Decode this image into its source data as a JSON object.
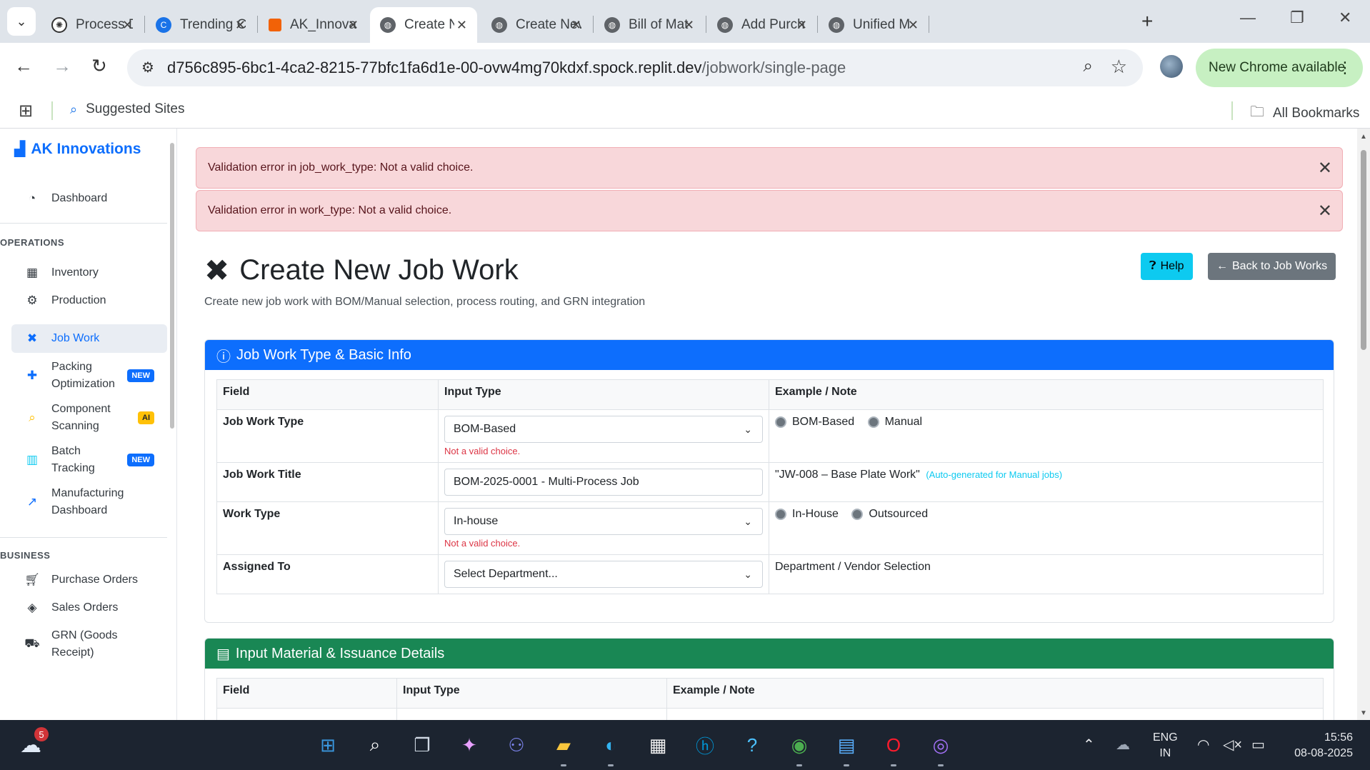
{
  "browser": {
    "tabs": [
      {
        "label": "Process De",
        "favicon": "openai-icon",
        "color": "#333333"
      },
      {
        "label": "Trending C",
        "favicon": "c-logo-icon",
        "color": "#1a73e8"
      },
      {
        "label": "AK_Innova",
        "favicon": "replit-icon",
        "color": "#f26207"
      },
      {
        "label": "Create Nev",
        "favicon": "globe-icon",
        "color": "#5f6368",
        "active": true
      },
      {
        "label": "Create Nev",
        "favicon": "globe-icon",
        "color": "#5f6368"
      },
      {
        "label": "Bill of Mat",
        "favicon": "globe-icon",
        "color": "#5f6368"
      },
      {
        "label": "Add Purch",
        "favicon": "globe-icon",
        "color": "#5f6368"
      },
      {
        "label": "Unified M",
        "favicon": "globe-icon",
        "color": "#5f6368"
      }
    ],
    "url_host": "d756c895-6bc1-4ca2-8215-77bfc1fa6d1e-00-ovw4mg70kdxf.spock.replit.dev",
    "url_path": "/jobwork/single-page",
    "new_chrome_label": "New Chrome available",
    "bookmarks": {
      "suggested": "Suggested Sites",
      "all": "All Bookmarks"
    }
  },
  "sidebar": {
    "brand": "AK Innovations",
    "dashboard": "Dashboard",
    "operations_heading": "OPERATIONS",
    "operations": [
      {
        "label": "Inventory",
        "icon": "boxes-icon"
      },
      {
        "label": "Production",
        "icon": "cogs-icon"
      },
      {
        "label": "Job Work",
        "icon": "tools-icon",
        "active": true
      },
      {
        "label_line1": "Packing",
        "label_line2": "Optimization",
        "icon": "puzzle-icon",
        "badge": "NEW"
      },
      {
        "label_line1": "Component",
        "label_line2": "Scanning",
        "icon": "search-icon",
        "badge": "AI"
      },
      {
        "label_line1": "Batch",
        "label_line2": "Tracking",
        "icon": "barcode-icon",
        "badge": "NEW"
      },
      {
        "label_line1": "Manufacturing",
        "label_line2": "Dashboard",
        "icon": "chart-line-icon"
      }
    ],
    "business_heading": "BUSINESS",
    "business": [
      {
        "label": "Purchase Orders",
        "icon": "cart-icon"
      },
      {
        "label": "Sales Orders",
        "icon": "handshake-icon"
      },
      {
        "label_line1": "GRN (Goods",
        "label_line2": "Receipt)",
        "icon": "truck-icon"
      }
    ]
  },
  "alerts": [
    "Validation error in job_work_type: Not a valid choice.",
    "Validation error in work_type: Not a valid choice."
  ],
  "page": {
    "title": "Create New Job Work",
    "subtitle": "Create new job work with BOM/Manual selection, process routing, and GRN integration",
    "help_label": "Help",
    "back_label": "Back to Job Works"
  },
  "section1": {
    "title": "Job Work Type & Basic Info",
    "headers": {
      "field": "Field",
      "input": "Input Type",
      "note": "Example / Note"
    },
    "rows": {
      "job_work_type": {
        "field": "Job Work Type",
        "value": "BOM-Based",
        "error": "Not a valid choice.",
        "radio1": "BOM-Based",
        "radio2": "Manual"
      },
      "job_work_title": {
        "field": "Job Work Title",
        "value": "BOM-2025-0001 - Multi-Process Job",
        "note": "\"JW-008 – Base Plate Work\"",
        "note_auto": "(Auto-generated for Manual jobs)"
      },
      "work_type": {
        "field": "Work Type",
        "value": "In-house",
        "error": "Not a valid choice.",
        "radio1": "In-House",
        "radio2": "Outsourced"
      },
      "assigned_to": {
        "field": "Assigned To",
        "value": "Select Department...",
        "note": "Department / Vendor Selection"
      }
    }
  },
  "section2": {
    "title": "Input Material & Issuance Details",
    "headers": {
      "field": "Field",
      "input": "Input Type",
      "note": "Example / Note"
    }
  },
  "taskbar": {
    "weather_badge": "5",
    "lang_line1": "ENG",
    "lang_line2": "IN",
    "time": "15:56",
    "date": "08-08-2025"
  }
}
